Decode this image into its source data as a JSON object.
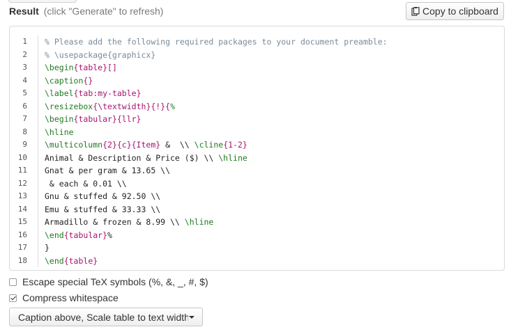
{
  "header": {
    "title": "Result",
    "hint": "(click \"Generate\" to refresh)"
  },
  "copy_button": {
    "label": "Copy to clipboard",
    "icon": "clipboard-icon"
  },
  "code": {
    "lines": [
      {
        "n": "1",
        "parts": [
          {
            "t": "% Please add the following required packages to your document preamble:",
            "c": "comment"
          }
        ]
      },
      {
        "n": "2",
        "parts": [
          {
            "t": "% \\usepackage{graphicx}",
            "c": "comment"
          }
        ]
      },
      {
        "n": "3",
        "parts": [
          {
            "t": "\\begin",
            "c": "cmd"
          },
          {
            "t": "{table}",
            "c": "arg"
          },
          {
            "t": "[]",
            "c": "arg"
          }
        ]
      },
      {
        "n": "4",
        "parts": [
          {
            "t": "\\caption",
            "c": "cmd"
          },
          {
            "t": "{}",
            "c": "arg"
          }
        ]
      },
      {
        "n": "5",
        "parts": [
          {
            "t": "\\label",
            "c": "cmd"
          },
          {
            "t": "{",
            "c": "arg"
          },
          {
            "t": "tab:my-table",
            "c": "arg"
          },
          {
            "t": "}",
            "c": "arg"
          }
        ]
      },
      {
        "n": "6",
        "parts": [
          {
            "t": "\\resizebox",
            "c": "cmd"
          },
          {
            "t": "{",
            "c": "arg"
          },
          {
            "t": "\\textwidth",
            "c": "arg"
          },
          {
            "t": "}{!}{",
            "c": "arg"
          },
          {
            "t": "%",
            "c": "cmd"
          }
        ]
      },
      {
        "n": "7",
        "parts": [
          {
            "t": "\\begin",
            "c": "cmd"
          },
          {
            "t": "{tabular}",
            "c": "arg"
          },
          {
            "t": "{llr}",
            "c": "arg"
          }
        ]
      },
      {
        "n": "8",
        "parts": [
          {
            "t": "\\hline",
            "c": "cmd"
          }
        ]
      },
      {
        "n": "9",
        "parts": [
          {
            "t": "\\multicolumn",
            "c": "cmd"
          },
          {
            "t": "{2}{c}{Item}",
            "c": "arg"
          },
          {
            "t": " &  \\\\ ",
            "c": "plain"
          },
          {
            "t": "\\cline",
            "c": "cmd"
          },
          {
            "t": "{1-2}",
            "c": "arg"
          }
        ]
      },
      {
        "n": "10",
        "parts": [
          {
            "t": "Animal & Description & Price ($) \\\\ ",
            "c": "plain"
          },
          {
            "t": "\\hline",
            "c": "cmd"
          }
        ]
      },
      {
        "n": "11",
        "parts": [
          {
            "t": "Gnat & per gram & 13.65 \\\\",
            "c": "plain"
          }
        ]
      },
      {
        "n": "12",
        "parts": [
          {
            "t": " & each & 0.01 \\\\",
            "c": "plain"
          }
        ]
      },
      {
        "n": "13",
        "parts": [
          {
            "t": "Gnu & stuffed & 92.50 \\\\",
            "c": "plain"
          }
        ]
      },
      {
        "n": "14",
        "parts": [
          {
            "t": "Emu & stuffed & 33.33 \\\\",
            "c": "plain"
          }
        ]
      },
      {
        "n": "15",
        "parts": [
          {
            "t": "Armadillo & frozen & 8.99 \\\\ ",
            "c": "plain"
          },
          {
            "t": "\\hline",
            "c": "cmd"
          }
        ]
      },
      {
        "n": "16",
        "parts": [
          {
            "t": "\\end",
            "c": "cmd"
          },
          {
            "t": "{tabular}",
            "c": "arg"
          },
          {
            "t": "%",
            "c": "plain"
          }
        ]
      },
      {
        "n": "17",
        "parts": [
          {
            "t": "}",
            "c": "plain"
          }
        ]
      },
      {
        "n": "18",
        "parts": [
          {
            "t": "\\end",
            "c": "cmd"
          },
          {
            "t": "{table}",
            "c": "arg"
          }
        ]
      }
    ]
  },
  "options": {
    "escape": {
      "label": "Escape special TeX symbols (%, &, _, #, $)",
      "checked": false
    },
    "compress": {
      "label": "Compress whitespace",
      "checked": true
    }
  },
  "dropdown": {
    "selected": "Caption above, Scale table to text width (default)"
  },
  "colors": {
    "comment": "#7a8a99",
    "command": "#1d7a1d",
    "argument": "#a6146e"
  }
}
